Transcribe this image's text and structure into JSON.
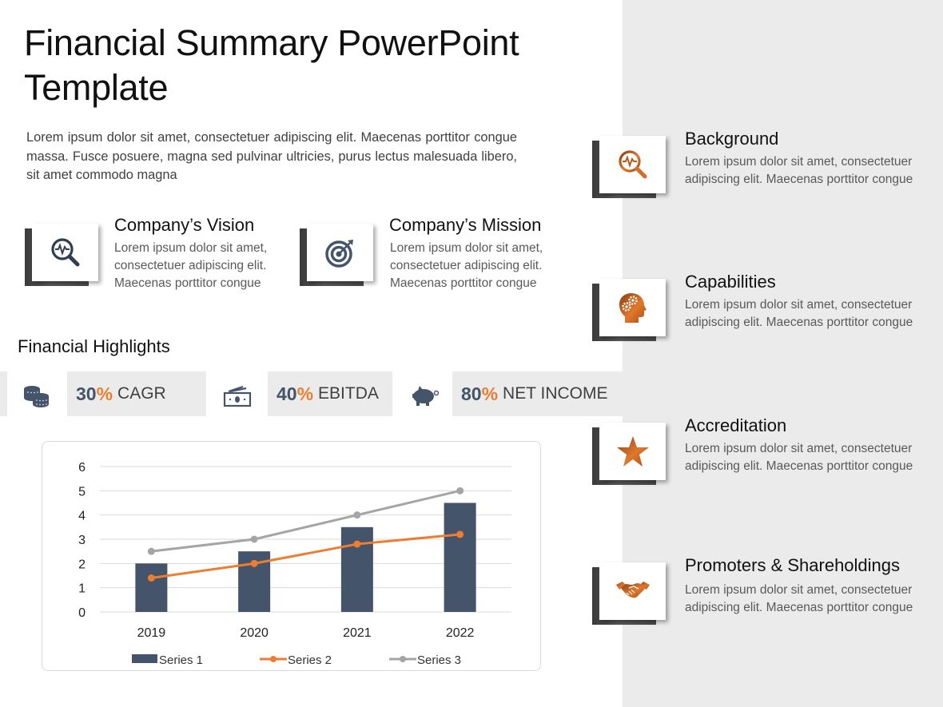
{
  "title": "Financial Summary PowerPoint Template",
  "title_lines": [
    "Financial Summary PowerPoint",
    "Template"
  ],
  "intro": "Lorem ipsum dolor sit amet, consectetuer adipiscing elit. Maecenas porttitor congue massa. Fusce posuere, magna sed pulvinar ultricies, purus lectus malesuada libero, sit amet commodo magna",
  "colors": {
    "accent_orange": "#ED7D31",
    "navy": "#44546A",
    "gray_series": "#A5A5A5",
    "panel_gray": "#EBEBEB"
  },
  "features": [
    {
      "title": "Company’s Vision",
      "text": "Lorem ipsum dolor sit amet, consectetuer adipiscing elit. Maecenas porttitor congue",
      "icon": "magnifier-pulse-icon"
    },
    {
      "title": "Company’s Mission",
      "text": "Lorem ipsum dolor sit amet, consectetuer adipiscing elit. Maecenas porttitor congue",
      "icon": "target-icon"
    }
  ],
  "highlights": {
    "title": "Financial Highlights",
    "items": [
      {
        "icon": "coins-icon",
        "number": "30",
        "percent": "%",
        "label": "CAGR"
      },
      {
        "icon": "cash-icon",
        "number": "40",
        "percent": "%",
        "label": "EBITDA"
      },
      {
        "icon": "piggy-bank-icon",
        "number": "80",
        "percent": "%",
        "label": "NET INCOME"
      }
    ]
  },
  "side_items": [
    {
      "title": "Background",
      "text": "Lorem ipsum dolor sit amet, consectetuer adipiscing elit. Maecenas porttitor congue",
      "icon": "magnifier-pulse-icon"
    },
    {
      "title": "Capabilities",
      "text": "Lorem ipsum dolor sit amet, consectetuer adipiscing elit. Maecenas porttitor congue",
      "icon": "head-gears-icon"
    },
    {
      "title": "Accreditation",
      "text": "Lorem ipsum dolor sit amet, consectetuer adipiscing elit. Maecenas porttitor congue",
      "icon": "star-icon"
    },
    {
      "title": "Promoters & Shareholdings",
      "text": "Lorem ipsum dolor sit amet, consectetuer adipiscing elit. Maecenas porttitor congue",
      "icon": "handshake-icon"
    }
  ],
  "chart_data": {
    "type": "bar",
    "title": "",
    "xlabel": "",
    "ylabel": "",
    "categories": [
      "2019",
      "2020",
      "2021",
      "2022"
    ],
    "ylim": [
      0,
      6
    ],
    "yticks": [
      0,
      1,
      2,
      3,
      4,
      5,
      6
    ],
    "grid": true,
    "legend": "bottom",
    "series": [
      {
        "name": "Series 1",
        "type": "bar",
        "color": "#44546A",
        "values": [
          2,
          2.5,
          3.5,
          4.5
        ]
      },
      {
        "name": "Series 2",
        "type": "line",
        "color": "#ED7D31",
        "values": [
          1.4,
          2,
          2.8,
          3.2
        ]
      },
      {
        "name": "Series 3",
        "type": "line",
        "color": "#A5A5A5",
        "values": [
          2.5,
          3,
          4,
          5
        ]
      }
    ]
  }
}
